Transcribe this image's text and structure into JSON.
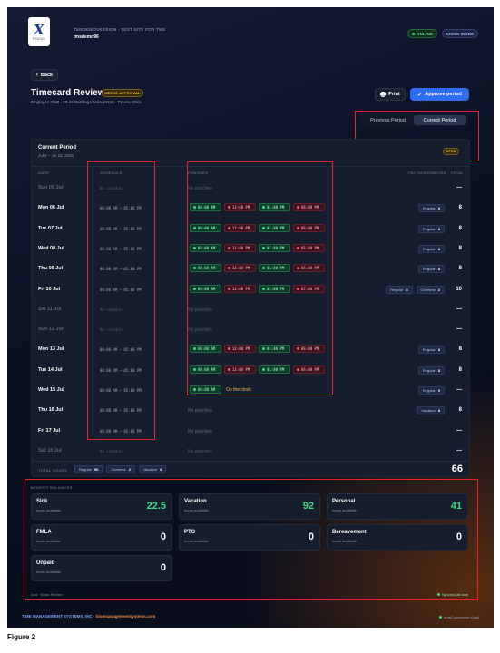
{
  "header": {
    "site": "TMSDEMOVERSION - TEST SITE FOR TMS",
    "user": "tmsdemo96",
    "logo_mark": "X",
    "logo_sub": "POCUS",
    "online": "ONLINE",
    "kiosk": "KIOSK MODE"
  },
  "nav": {
    "back": "Back"
  },
  "page": {
    "title": "Timecard Review",
    "status": "NEEDS APPROVAL",
    "employee": "Employee #222 · 20-ml-Building Interia-10196 - Peters, Chris",
    "print": "Print",
    "approve": "Approve period"
  },
  "period_tabs": {
    "previous": "Previous Period",
    "current": "Current Period"
  },
  "period": {
    "title": "Current Period",
    "range": "Jul 5 – Jul 18, 2026",
    "badge": "OPEN"
  },
  "columns": {
    "date": "DATE",
    "schedule": "SCHEDULE",
    "punches": "PUNCHES",
    "pay": "PAY DESIGNATION · TOTAL"
  },
  "rows": [
    {
      "date": "Sun 05 Jul",
      "weekend": true,
      "schedule": "No schedule",
      "punches": [],
      "empty_punches": "No punches",
      "tags": [],
      "total": "—"
    },
    {
      "date": "Mon 06 Jul",
      "schedule": "08:00 AM – 05:00 PM",
      "punches": [
        {
          "t": "08:00 AM",
          "k": "in"
        },
        {
          "t": "12:00 PM",
          "k": "out"
        },
        {
          "t": "01:00 PM",
          "k": "in"
        },
        {
          "t": "05:00 PM",
          "k": "out"
        }
      ],
      "tags": [
        {
          "label": "Regular",
          "value": "8"
        }
      ],
      "total": "8"
    },
    {
      "date": "Tue 07 Jul",
      "schedule": "08:00 AM – 05:00 PM",
      "punches": [
        {
          "t": "08:00 AM",
          "k": "in"
        },
        {
          "t": "12:00 PM",
          "k": "out"
        },
        {
          "t": "01:00 PM",
          "k": "in"
        },
        {
          "t": "05:00 PM",
          "k": "out"
        }
      ],
      "tags": [
        {
          "label": "Regular",
          "value": "8"
        }
      ],
      "total": "8"
    },
    {
      "date": "Wed 08 Jul",
      "schedule": "08:00 AM – 05:00 PM",
      "punches": [
        {
          "t": "08:00 AM",
          "k": "in"
        },
        {
          "t": "12:00 PM",
          "k": "out"
        },
        {
          "t": "01:00 PM",
          "k": "in"
        },
        {
          "t": "05:00 PM",
          "k": "out"
        }
      ],
      "tags": [
        {
          "label": "Regular",
          "value": "8"
        }
      ],
      "total": "8"
    },
    {
      "date": "Thu 09 Jul",
      "schedule": "08:00 AM – 05:00 PM",
      "punches": [
        {
          "t": "08:00 AM",
          "k": "in"
        },
        {
          "t": "12:00 PM",
          "k": "out"
        },
        {
          "t": "01:00 PM",
          "k": "in"
        },
        {
          "t": "05:00 PM",
          "k": "out"
        }
      ],
      "tags": [
        {
          "label": "Regular",
          "value": "8"
        }
      ],
      "total": "8"
    },
    {
      "date": "Fri 10 Jul",
      "schedule": "08:00 AM – 05:00 PM",
      "punches": [
        {
          "t": "08:00 AM",
          "k": "in"
        },
        {
          "t": "12:00 PM",
          "k": "out"
        },
        {
          "t": "01:00 PM",
          "k": "in"
        },
        {
          "t": "07:00 PM",
          "k": "out"
        }
      ],
      "tags": [
        {
          "label": "Regular",
          "value": "8"
        },
        {
          "label": "Overtime",
          "value": "2"
        }
      ],
      "total": "10"
    },
    {
      "date": "Sat 11 Jul",
      "weekend": true,
      "schedule": "No schedule",
      "punches": [],
      "empty_punches": "No punches",
      "tags": [],
      "total": "—"
    },
    {
      "date": "Sun 12 Jul",
      "weekend": true,
      "schedule": "No schedule",
      "punches": [],
      "empty_punches": "No punches",
      "tags": [],
      "total": "—"
    },
    {
      "date": "Mon 13 Jul",
      "schedule": "08:00 AM – 05:00 PM",
      "punches": [
        {
          "t": "08:00 AM",
          "k": "in"
        },
        {
          "t": "12:00 PM",
          "k": "out"
        },
        {
          "t": "01:00 PM",
          "k": "in"
        },
        {
          "t": "05:00 PM",
          "k": "out"
        }
      ],
      "tags": [
        {
          "label": "Regular",
          "value": "8"
        }
      ],
      "total": "8"
    },
    {
      "date": "Tue 14 Jul",
      "schedule": "08:00 AM – 05:00 PM",
      "punches": [
        {
          "t": "08:00 AM",
          "k": "in"
        },
        {
          "t": "12:00 PM",
          "k": "out"
        },
        {
          "t": "01:00 PM",
          "k": "in"
        },
        {
          "t": "05:00 PM",
          "k": "out"
        }
      ],
      "tags": [
        {
          "label": "Regular",
          "value": "8"
        }
      ],
      "total": "8"
    },
    {
      "date": "Wed 15 Jul",
      "schedule": "08:00 AM – 05:00 PM",
      "punches": [
        {
          "t": "08:00 AM",
          "k": "in"
        }
      ],
      "on_clock": "On the clock",
      "tags": [
        {
          "label": "Regular",
          "value": "0"
        }
      ],
      "total": "—"
    },
    {
      "date": "Thu 16 Jul",
      "schedule": "08:00 AM – 05:00 PM",
      "punches": [],
      "empty_punches": "No punches",
      "tags": [
        {
          "label": "Vacation",
          "value": "8"
        }
      ],
      "total": "8"
    },
    {
      "date": "Fri 17 Jul",
      "schedule": "08:00 AM – 05:00 PM",
      "punches": [],
      "empty_punches": "No punches",
      "tags": [],
      "total": "—"
    },
    {
      "date": "Sat 18 Jul",
      "weekend": true,
      "schedule": "No schedule",
      "punches": [],
      "empty_punches": "No punches",
      "tags": [],
      "total": "—"
    }
  ],
  "totals": {
    "label": "TOTAL HOURS",
    "tags": [
      {
        "label": "Regular",
        "value": "56"
      },
      {
        "label": "Overtime",
        "value": "2"
      },
      {
        "label": "Vacation",
        "value": "8"
      }
    ],
    "total": "66"
  },
  "benefits": {
    "title": "BENEFIT BALANCES",
    "sub": "hours available",
    "items": [
      {
        "name": "Sick",
        "value": "22.5",
        "color": "#3ddc84"
      },
      {
        "name": "Vacation",
        "value": "92",
        "color": "#3ddc84"
      },
      {
        "name": "Personal",
        "value": "41",
        "color": "#3ddc84"
      },
      {
        "name": "FMLA",
        "value": "0",
        "color": "#ffffff"
      },
      {
        "name": "PTO",
        "value": "0",
        "color": "#ffffff"
      },
      {
        "name": "Bereavement",
        "value": "0",
        "color": "#ffffff"
      },
      {
        "name": "Unpaid",
        "value": "0",
        "color": "#ffffff"
      }
    ]
  },
  "statusbar": {
    "left": "Ana · Kiosk Review",
    "right": "Synced just now"
  },
  "footer": {
    "company": "TIME MANAGEMENT SYSTEMS, INC",
    "site": "timemanagementsystems.com",
    "right": "timeConnection Kiosk"
  },
  "caption": "Figure 2",
  "icons": {
    "back": "chevron-left-icon",
    "print": "printer-icon",
    "approve": "check-icon"
  }
}
